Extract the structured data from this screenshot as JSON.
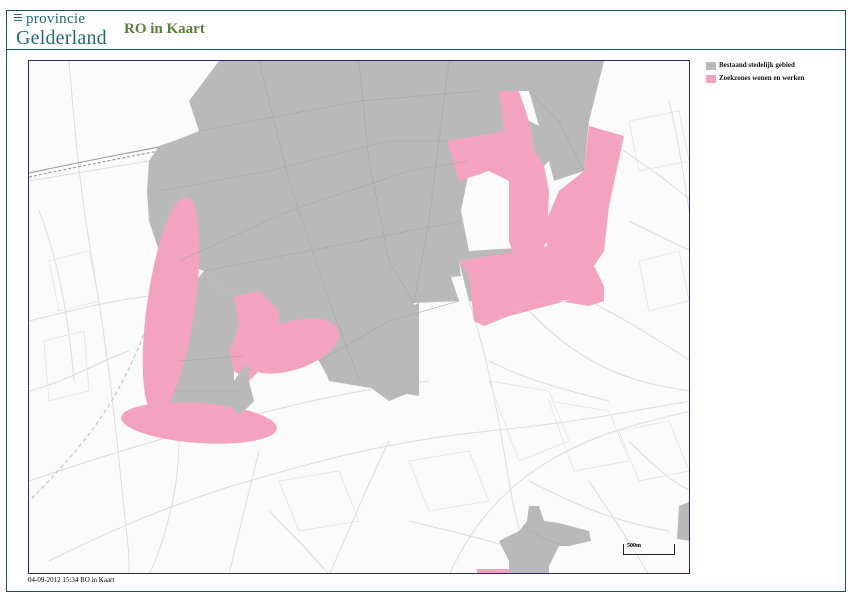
{
  "header": {
    "logo_top": "provincie",
    "logo_bottom": "Gelderland",
    "app_title": "RO in Kaart"
  },
  "legend": {
    "items": [
      {
        "label": "Bestaand stedelijk gebied",
        "color": "#b9b9b9"
      },
      {
        "label": "Zoekzones wonen en werken",
        "color": "#f3a3c0"
      }
    ]
  },
  "map": {
    "scalebar_label": "500m",
    "colors": {
      "built_area": "#b9b9b9",
      "search_zone": "#f3a3c0",
      "road": "#d8d8d8",
      "railway": "#9a9a9a",
      "background": "#fbfbfb"
    }
  },
  "footer": {
    "timestamp": "04-09-2012 15:34 RO in Kaart"
  }
}
